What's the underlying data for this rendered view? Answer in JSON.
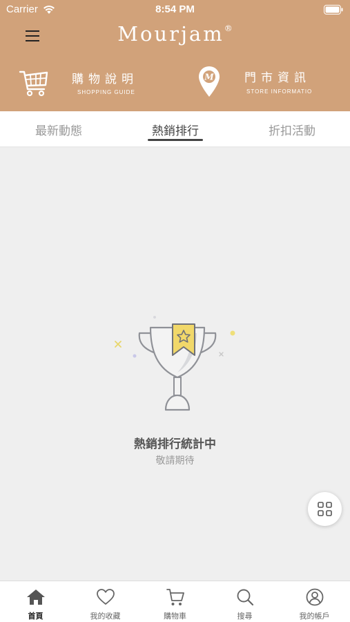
{
  "status_bar": {
    "carrier": "Carrier",
    "time": "8:54 PM"
  },
  "header": {
    "brand": "Mourjam",
    "brand_mark": "®",
    "quick_links": [
      {
        "label": "購物說明",
        "sublabel": "SHOPPING GUIDE",
        "icon": "shopping-cart-icon"
      },
      {
        "label": "門市資訊",
        "sublabel": "STORE INFORMATIO",
        "icon": "map-pin-icon"
      }
    ]
  },
  "tabs": [
    {
      "label": "最新動態",
      "active": false
    },
    {
      "label": "熱銷排行",
      "active": true
    },
    {
      "label": "折扣活動",
      "active": false
    }
  ],
  "empty_state": {
    "icon": "trophy-icon",
    "title": "熱銷排行統計中",
    "subtitle": "敬請期待"
  },
  "fab": {
    "icon": "grid-icon"
  },
  "tab_bar": [
    {
      "label": "首頁",
      "icon": "home-icon",
      "active": true
    },
    {
      "label": "我的收藏",
      "icon": "heart-icon",
      "active": false
    },
    {
      "label": "購物車",
      "icon": "cart-icon",
      "active": false
    },
    {
      "label": "搜尋",
      "icon": "search-icon",
      "active": false
    },
    {
      "label": "我的帳戶",
      "icon": "account-icon",
      "active": false
    }
  ],
  "colors": {
    "header_bg": "#d1a27a",
    "background": "#efefef",
    "trophy_ribbon": "#f1d86a"
  }
}
